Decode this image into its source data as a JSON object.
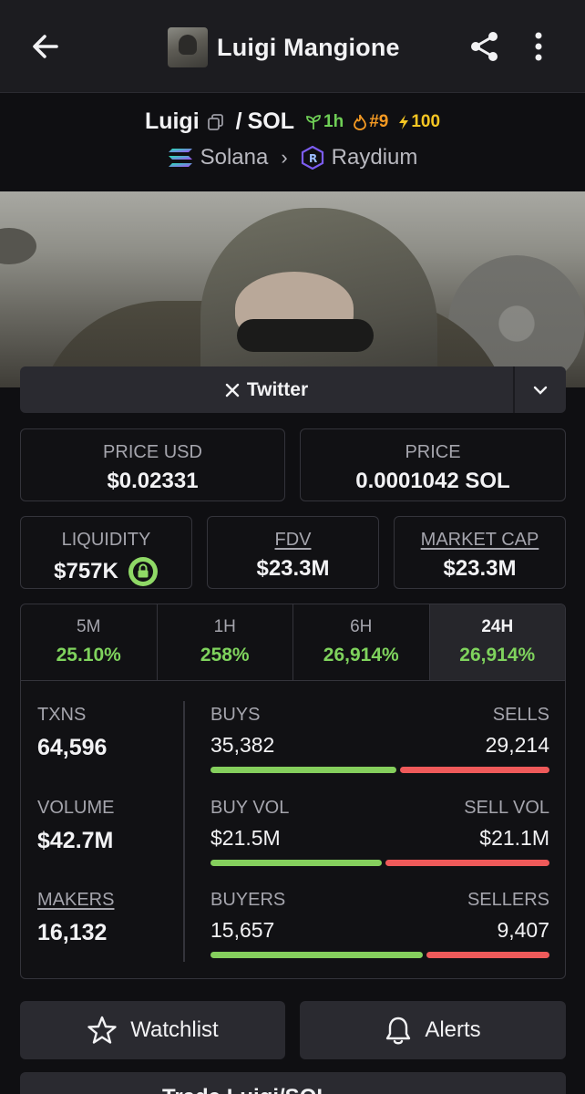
{
  "header": {
    "title": "Luigi Mangione"
  },
  "pair": {
    "base": "Luigi",
    "separator": "/",
    "quote": "SOL",
    "age": "1h",
    "rank": "#9",
    "boost": "100",
    "chain": "Solana",
    "dex": "Raydium"
  },
  "social": {
    "twitter_label": "Twitter"
  },
  "price": {
    "usd_label": "PRICE USD",
    "usd_value": "$0.02331",
    "native_label": "PRICE",
    "native_value": "0.0001042 SOL"
  },
  "metrics": {
    "liquidity_label": "LIQUIDITY",
    "liquidity_value": "$757K",
    "fdv_label": "FDV",
    "fdv_value": "$23.3M",
    "mcap_label": "MARKET CAP",
    "mcap_value": "$23.3M"
  },
  "timeframes": [
    {
      "label": "5M",
      "value": "25.10%"
    },
    {
      "label": "1H",
      "value": "258%"
    },
    {
      "label": "6H",
      "value": "26,914%"
    },
    {
      "label": "24H",
      "value": "26,914%"
    }
  ],
  "stats": {
    "txns_label": "TXNS",
    "txns_value": "64,596",
    "volume_label": "VOLUME",
    "volume_value": "$42.7M",
    "makers_label": "MAKERS",
    "makers_value": "16,132",
    "buys_label": "BUYS",
    "buys_value": "35,382",
    "sells_label": "SELLS",
    "sells_value": "29,214",
    "buyvol_label": "BUY VOL",
    "buyvol_value": "$21.5M",
    "sellvol_label": "SELL VOL",
    "sellvol_value": "$21.1M",
    "buyers_label": "BUYERS",
    "buyers_value": "15,657",
    "sellers_label": "SELLERS",
    "sellers_value": "9,407"
  },
  "ratios": {
    "buys": 0.548,
    "buy_vol": 0.505,
    "buyers": 0.625
  },
  "actions": {
    "watchlist_label": "Watchlist",
    "alerts_label": "Alerts",
    "trade_label": "Trade Luigi/SOL"
  },
  "colors": {
    "accent_green": "#7fd35d",
    "sell_red": "#ef5a5a",
    "boost_yellow": "#f5c623",
    "rank_orange": "#f59a23"
  },
  "icons": [
    "back-arrow-icon",
    "share-icon",
    "more-vertical-icon",
    "copy-icon",
    "seedling-icon",
    "flame-icon",
    "lightning-icon",
    "solana-icon",
    "raydium-icon",
    "x-logo-icon",
    "chevron-down-icon",
    "lock-icon",
    "star-icon",
    "bell-icon"
  ]
}
